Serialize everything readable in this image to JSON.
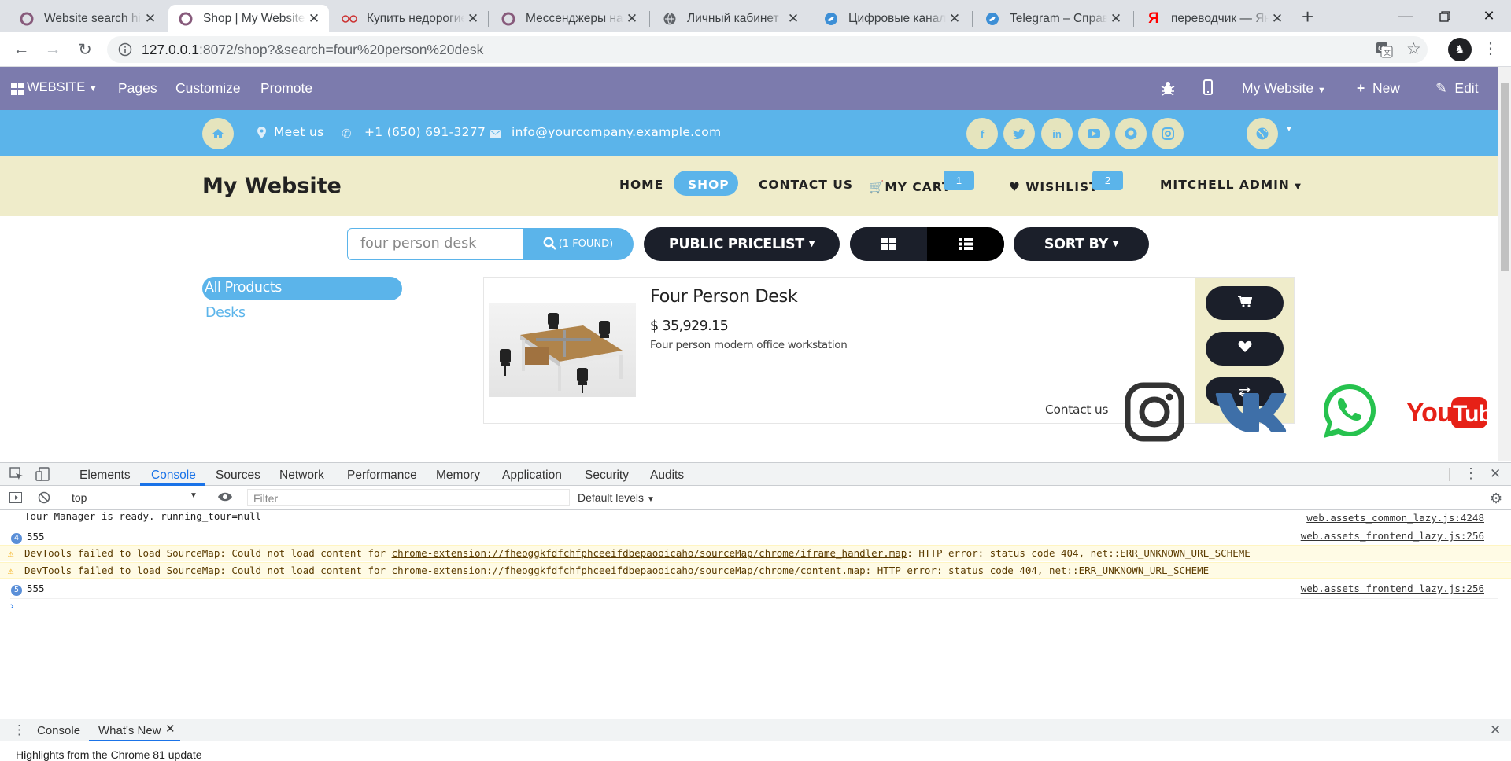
{
  "browser": {
    "tabs": [
      {
        "title": "Website search his",
        "icon": "odoo-icon"
      },
      {
        "title": "Shop | My Website",
        "icon": "odoo-icon",
        "active": true
      },
      {
        "title": "Купить недорогие",
        "icon": "glasses-icon"
      },
      {
        "title": "Мессенджеры на",
        "icon": "odoo-icon"
      },
      {
        "title": "Личный кабинет",
        "icon": "globe-icon"
      },
      {
        "title": "Цифровые каналы",
        "icon": "bird-icon"
      },
      {
        "title": "Telegram – Справо",
        "icon": "bird-icon"
      },
      {
        "title": "переводчик — Ян",
        "icon": "yandex-icon"
      }
    ],
    "new_tab": "+",
    "url_host": "127.0.0.1",
    "url_rest": ":8072/shop?&search=four%20person%20desk"
  },
  "odoo_bar": {
    "website": "WEBSITE",
    "pages": "Pages",
    "customize": "Customize",
    "promote": "Promote",
    "my_website": "My Website",
    "new": "New",
    "edit": "Edit"
  },
  "contact_bar": {
    "meet": "Meet us",
    "phone": "+1 (650) 691-3277",
    "email": "info@yourcompany.example.com",
    "socials": [
      "f",
      "t",
      "in",
      "yt",
      "gh",
      "ig"
    ]
  },
  "header": {
    "brand": "My Website",
    "menu": {
      "home": "HOME",
      "shop": "SHOP",
      "contact": "CONTACT US",
      "cart": "MY CART",
      "wishlist": "WISHLIST",
      "user": "MITCHELL ADMIN"
    },
    "cart_count": "1",
    "wishlist_count": "2"
  },
  "shop": {
    "search_value": "four person desk",
    "search_result": "(1 FOUND)",
    "pricelist": "PUBLIC PRICELIST",
    "sort": "SORT BY",
    "categories": [
      "All Products",
      "Desks"
    ],
    "product": {
      "name": "Four Person Desk",
      "price": "$ 35,929.15",
      "description": "Four person modern office workstation"
    },
    "contact_us": "Contact us"
  },
  "devtools": {
    "tabs": [
      "Elements",
      "Console",
      "Sources",
      "Network",
      "Performance",
      "Memory",
      "Application",
      "Security",
      "Audits"
    ],
    "context": "top",
    "filter_placeholder": "Filter",
    "levels": "Default levels",
    "log": [
      {
        "text": "Tour Manager is ready.  running_tour=null",
        "src": "web.assets_common_lazy.js:4248",
        "type": "info"
      },
      {
        "count": "4",
        "text": "555",
        "src": "web.assets_frontend_lazy.js:256",
        "type": "count"
      },
      {
        "text_pre": "DevTools failed to load SourceMap: Could not load content for ",
        "link": "chrome-extension://fheoggkfdfchfphceeifdbepaooicaho/sourceMap/chrome/iframe_handler.map",
        "text_post": ": HTTP error: status code 404, net::ERR_UNKNOWN_URL_SCHEME",
        "type": "warn"
      },
      {
        "text_pre": "DevTools failed to load SourceMap: Could not load content for ",
        "link": "chrome-extension://fheoggkfdfchfphceeifdbepaooicaho/sourceMap/chrome/content.map",
        "text_post": ": HTTP error: status code 404, net::ERR_UNKNOWN_URL_SCHEME",
        "type": "warn"
      },
      {
        "count": "5",
        "text": "555",
        "src": "web.assets_frontend_lazy.js:256",
        "type": "count"
      }
    ],
    "drawer_tabs": [
      "Console",
      "What's New"
    ],
    "whats_new": "Highlights from the Chrome 81 update"
  },
  "colors": {
    "odoo_purple": "#7c7bad",
    "contact_blue": "#5bb4ea",
    "header_beige": "#efecca",
    "dark_pill": "#1b1f2a"
  }
}
